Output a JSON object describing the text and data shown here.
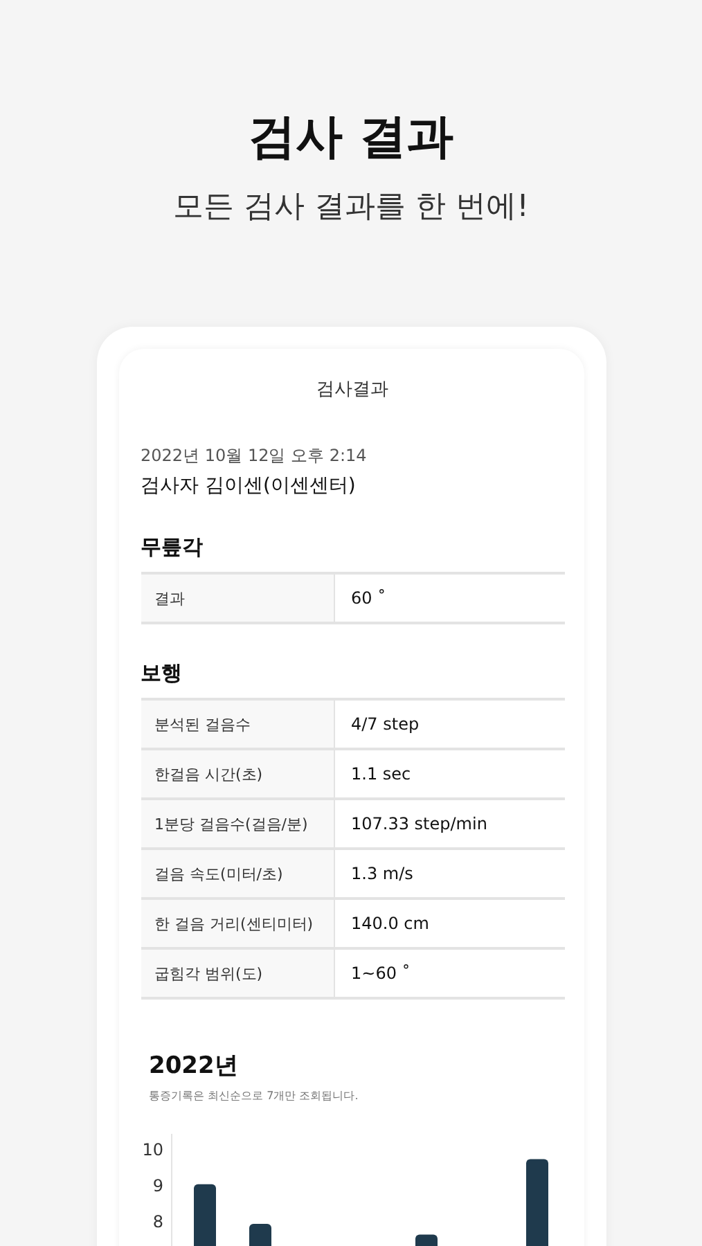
{
  "header": {
    "title": "검사 결과",
    "subtitle": "모든 검사 결과를 한 번에!"
  },
  "card": {
    "title": "검사결과",
    "datetime": "2022년 10월 12일 오후 2:14",
    "examiner": "검사자 김이센(이센센터)",
    "sections": [
      {
        "heading": "무릎각",
        "rows": [
          {
            "label": "결과",
            "value": "60 ˚"
          }
        ]
      },
      {
        "heading": "보행",
        "rows": [
          {
            "label": "분석된 걸음수",
            "value": "4/7 step"
          },
          {
            "label": "한걸음 시간(초)",
            "value": "1.1 sec"
          },
          {
            "label": "1분당 걸음수(걸음/분)",
            "value": "107.33 step/min"
          },
          {
            "label": "걸음 속도(미터/초)",
            "value": "1.3 m/s"
          },
          {
            "label": "한 걸음 거리(센티미터)",
            "value": "140.0 cm"
          },
          {
            "label": "굽힘각 범위(도)",
            "value": "1~60 ˚"
          }
        ]
      }
    ],
    "year": {
      "title": "2022년",
      "note": "통증기록은 최신순으로 7개만 조회됩니다.",
      "chart_data": {
        "type": "bar",
        "categories": [
          null,
          null,
          null,
          null
        ],
        "series": [
          {
            "color": "#1f3a4d",
            "values": [
              9.0,
              7.9,
              7.6,
              9.7
            ]
          }
        ],
        "ylim": [
          5.35,
          10.4
        ],
        "yticks": [
          8,
          9,
          10
        ]
      }
    }
  }
}
